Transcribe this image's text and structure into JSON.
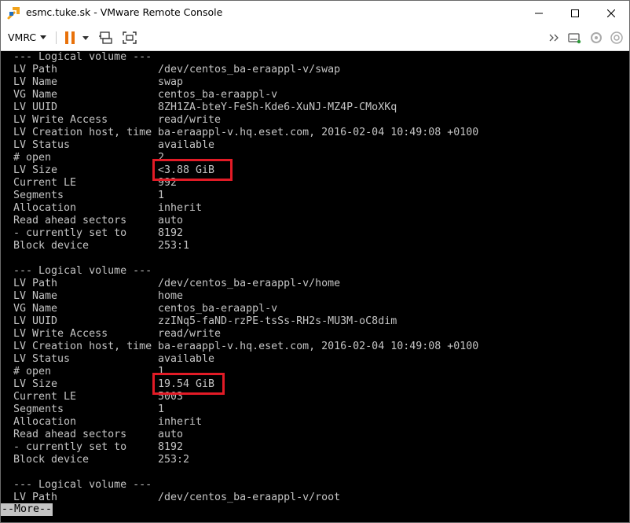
{
  "window": {
    "title": "esmc.tuke.sk - VMware Remote Console",
    "icons": [
      "vmrc-app-icon",
      "minimize-icon",
      "maximize-icon",
      "close-icon"
    ]
  },
  "toolbar": {
    "vmrc_label": "VMRC",
    "icons": [
      "vmrc-menu-chevron-icon",
      "pause-icon",
      "pause-dropdown-icon",
      "send-ctrl-alt-del-icon",
      "fullscreen-icon",
      "chevron-right-icon",
      "removable-devices-icon",
      "settings-icon",
      "help-icon"
    ],
    "pause_color": "#e8710a"
  },
  "console": {
    "text_color": "#c4c4c4",
    "more_prompt": "--More--",
    "volumes": [
      {
        "header": "--- Logical volume ---",
        "rows": [
          {
            "label": "LV Path",
            "value": "/dev/centos_ba-eraappl-v/swap"
          },
          {
            "label": "LV Name",
            "value": "swap"
          },
          {
            "label": "VG Name",
            "value": "centos_ba-eraappl-v"
          },
          {
            "label": "LV UUID",
            "value": "8ZH1ZA-bteY-FeSh-Kde6-XuNJ-MZ4P-CMoXKq"
          },
          {
            "label": "LV Write Access",
            "value": "read/write"
          },
          {
            "label": "LV Creation host, time",
            "value": "ba-eraappl-v.hq.eset.com, 2016-02-04 10:49:08 +0100"
          },
          {
            "label": "LV Status",
            "value": "available"
          },
          {
            "label": "# open",
            "value": "2"
          },
          {
            "label": "LV Size",
            "value": "<3.88 GiB"
          },
          {
            "label": "Current LE",
            "value": "992"
          },
          {
            "label": "Segments",
            "value": "1"
          },
          {
            "label": "Allocation",
            "value": "inherit"
          },
          {
            "label": "Read ahead sectors",
            "value": "auto"
          },
          {
            "label": "- currently set to",
            "value": "8192"
          },
          {
            "label": "Block device",
            "value": "253:1"
          }
        ]
      },
      {
        "header": "--- Logical volume ---",
        "rows": [
          {
            "label": "LV Path",
            "value": "/dev/centos_ba-eraappl-v/home"
          },
          {
            "label": "LV Name",
            "value": "home"
          },
          {
            "label": "VG Name",
            "value": "centos_ba-eraappl-v"
          },
          {
            "label": "LV UUID",
            "value": "zzINq5-faND-rzPE-tsSs-RH2s-MU3M-oC8dim"
          },
          {
            "label": "LV Write Access",
            "value": "read/write"
          },
          {
            "label": "LV Creation host, time",
            "value": "ba-eraappl-v.hq.eset.com, 2016-02-04 10:49:08 +0100"
          },
          {
            "label": "LV Status",
            "value": "available"
          },
          {
            "label": "# open",
            "value": "1"
          },
          {
            "label": "LV Size",
            "value": "19.54 GiB"
          },
          {
            "label": "Current LE",
            "value": "5003"
          },
          {
            "label": "Segments",
            "value": "1"
          },
          {
            "label": "Allocation",
            "value": "inherit"
          },
          {
            "label": "Read ahead sectors",
            "value": "auto"
          },
          {
            "label": "- currently set to",
            "value": "8192"
          },
          {
            "label": "Block device",
            "value": "253:2"
          }
        ]
      },
      {
        "header": "--- Logical volume ---",
        "rows": [
          {
            "label": "LV Path",
            "value": "/dev/centos_ba-eraappl-v/root"
          }
        ]
      }
    ],
    "highlight_color": "#e21b26",
    "highlighted_values": [
      "<3.88 GiB",
      "19.54 GiB"
    ]
  }
}
